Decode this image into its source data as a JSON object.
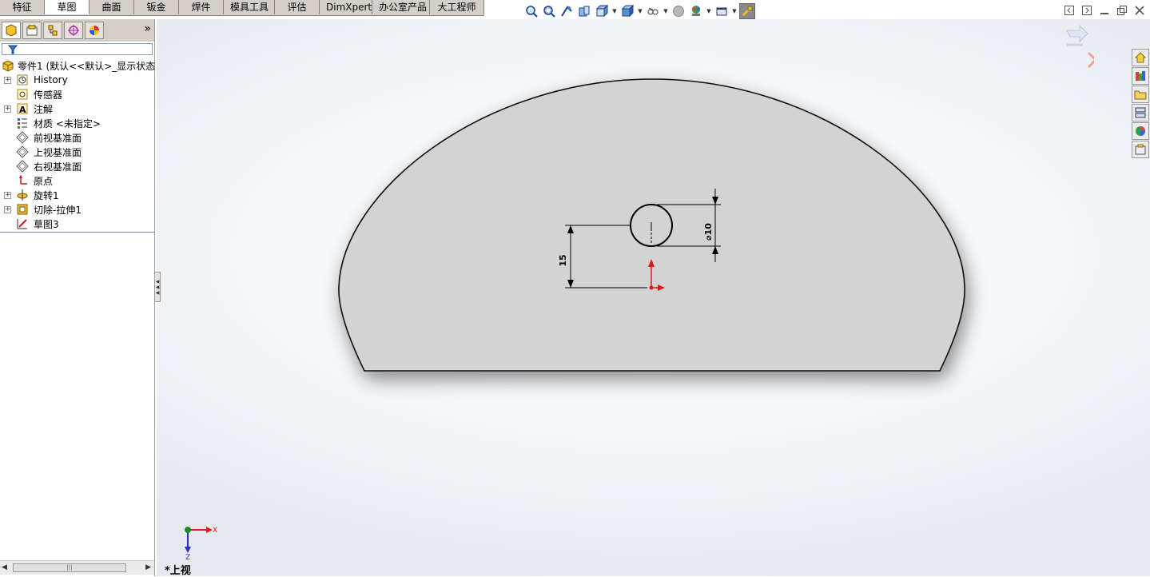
{
  "command_tabs": [
    "特征",
    "草图",
    "曲面",
    "钣金",
    "焊件",
    "模具工具",
    "评估",
    "DimXpert",
    "办公室产品",
    "大工程师"
  ],
  "active_tab": "草图",
  "tree": {
    "root": "零件1  (默认<<默认>_显示状态",
    "items": [
      {
        "label": "History",
        "icon": "history-icon",
        "expandable": true
      },
      {
        "label": "传感器",
        "icon": "sensor-icon",
        "expandable": false
      },
      {
        "label": "注解",
        "icon": "annotation-icon",
        "expandable": true
      },
      {
        "label": "材质 <未指定>",
        "icon": "material-icon",
        "expandable": false
      },
      {
        "label": "前视基准面",
        "icon": "plane-icon",
        "expandable": false
      },
      {
        "label": "上视基准面",
        "icon": "plane-icon",
        "expandable": false
      },
      {
        "label": "右视基准面",
        "icon": "plane-icon",
        "expandable": false
      },
      {
        "label": "原点",
        "icon": "origin-icon",
        "expandable": false
      },
      {
        "label": "旋转1",
        "icon": "revolve-icon",
        "expandable": true
      },
      {
        "label": "切除-拉伸1",
        "icon": "cut-extrude-icon",
        "expandable": true
      },
      {
        "label": "草图3",
        "icon": "sketch-icon",
        "expandable": false
      }
    ]
  },
  "drawing": {
    "dim_diameter": "⌀10",
    "dim_distance": "15"
  },
  "triad": {
    "x": "X",
    "z": "Z"
  },
  "view_name": "*上视",
  "colors": {
    "accent_red": "#e01818",
    "part_face": "#d3d3d3",
    "triad_blue": "#2030c8"
  }
}
